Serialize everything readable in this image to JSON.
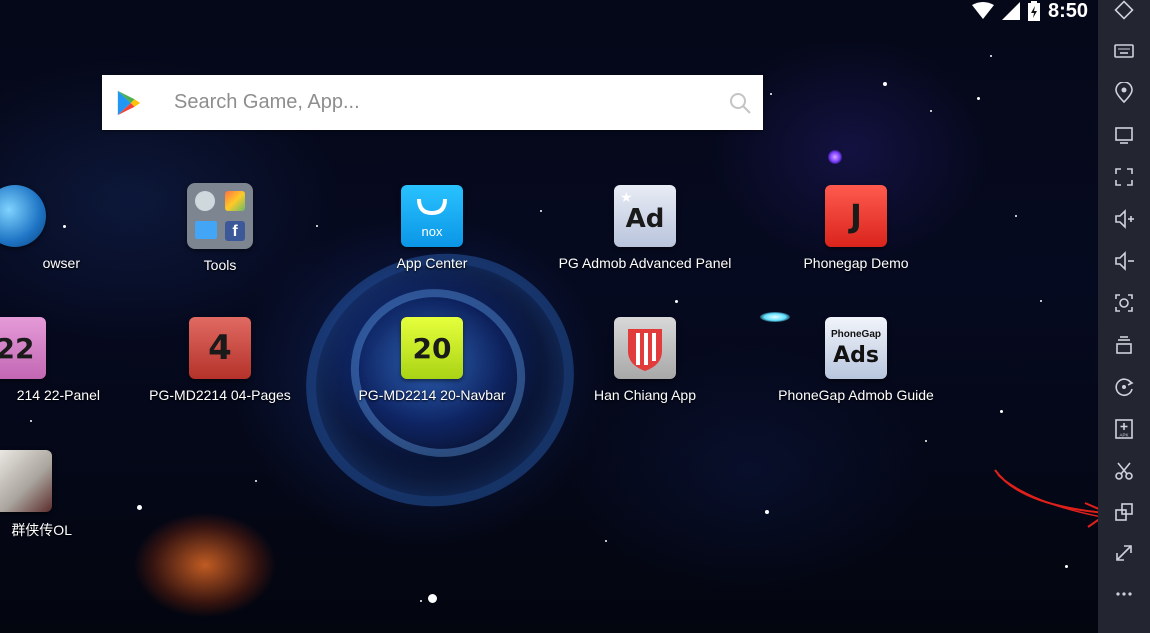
{
  "status_bar": {
    "time": "8:50"
  },
  "search": {
    "placeholder": "Search Game, App..."
  },
  "apps": [
    {
      "label": "owser",
      "key": "browser"
    },
    {
      "label": "Tools",
      "key": "tools"
    },
    {
      "label": "App Center",
      "key": "app-center",
      "icon_text": "nox"
    },
    {
      "label": "PG Admob Advanced Panel",
      "key": "pg-admob-advanced-panel",
      "icon_text": "Ad"
    },
    {
      "label": "Phonegap Demo",
      "key": "phonegap-demo",
      "icon_text": "J"
    },
    {
      "label": "214 22-Panel",
      "key": "pg-md2214-22-panel",
      "icon_text": "22"
    },
    {
      "label": "PG-MD2214 04-Pages",
      "key": "pg-md2214-04-pages",
      "icon_text": "4"
    },
    {
      "label": "PG-MD2214 20-Navbar",
      "key": "pg-md2214-20-navbar",
      "icon_text": "20"
    },
    {
      "label": "Han Chiang App",
      "key": "han-chiang-app"
    },
    {
      "label": "PhoneGap Admob Guide",
      "key": "phonegap-admob-guide",
      "icon_text_top": "PhoneGap",
      "icon_text": "Ads"
    },
    {
      "label": "群侠传OL",
      "key": "qunxiazhuan-ol"
    }
  ],
  "toolbar": {
    "items": [
      "rotate-icon",
      "keyboard-icon",
      "location-icon",
      "screen-icon",
      "fullscreen-icon",
      "volume-up-icon",
      "volume-down-icon",
      "screenshot-icon",
      "stack-icon",
      "shake-icon",
      "apk-install-icon",
      "scissors-icon",
      "multi-instance-icon",
      "resize-icon",
      "more-icon"
    ],
    "apk_text": "APK"
  },
  "colors": {
    "toolbar_bg": "#232530",
    "annotation": "#e0201a"
  }
}
